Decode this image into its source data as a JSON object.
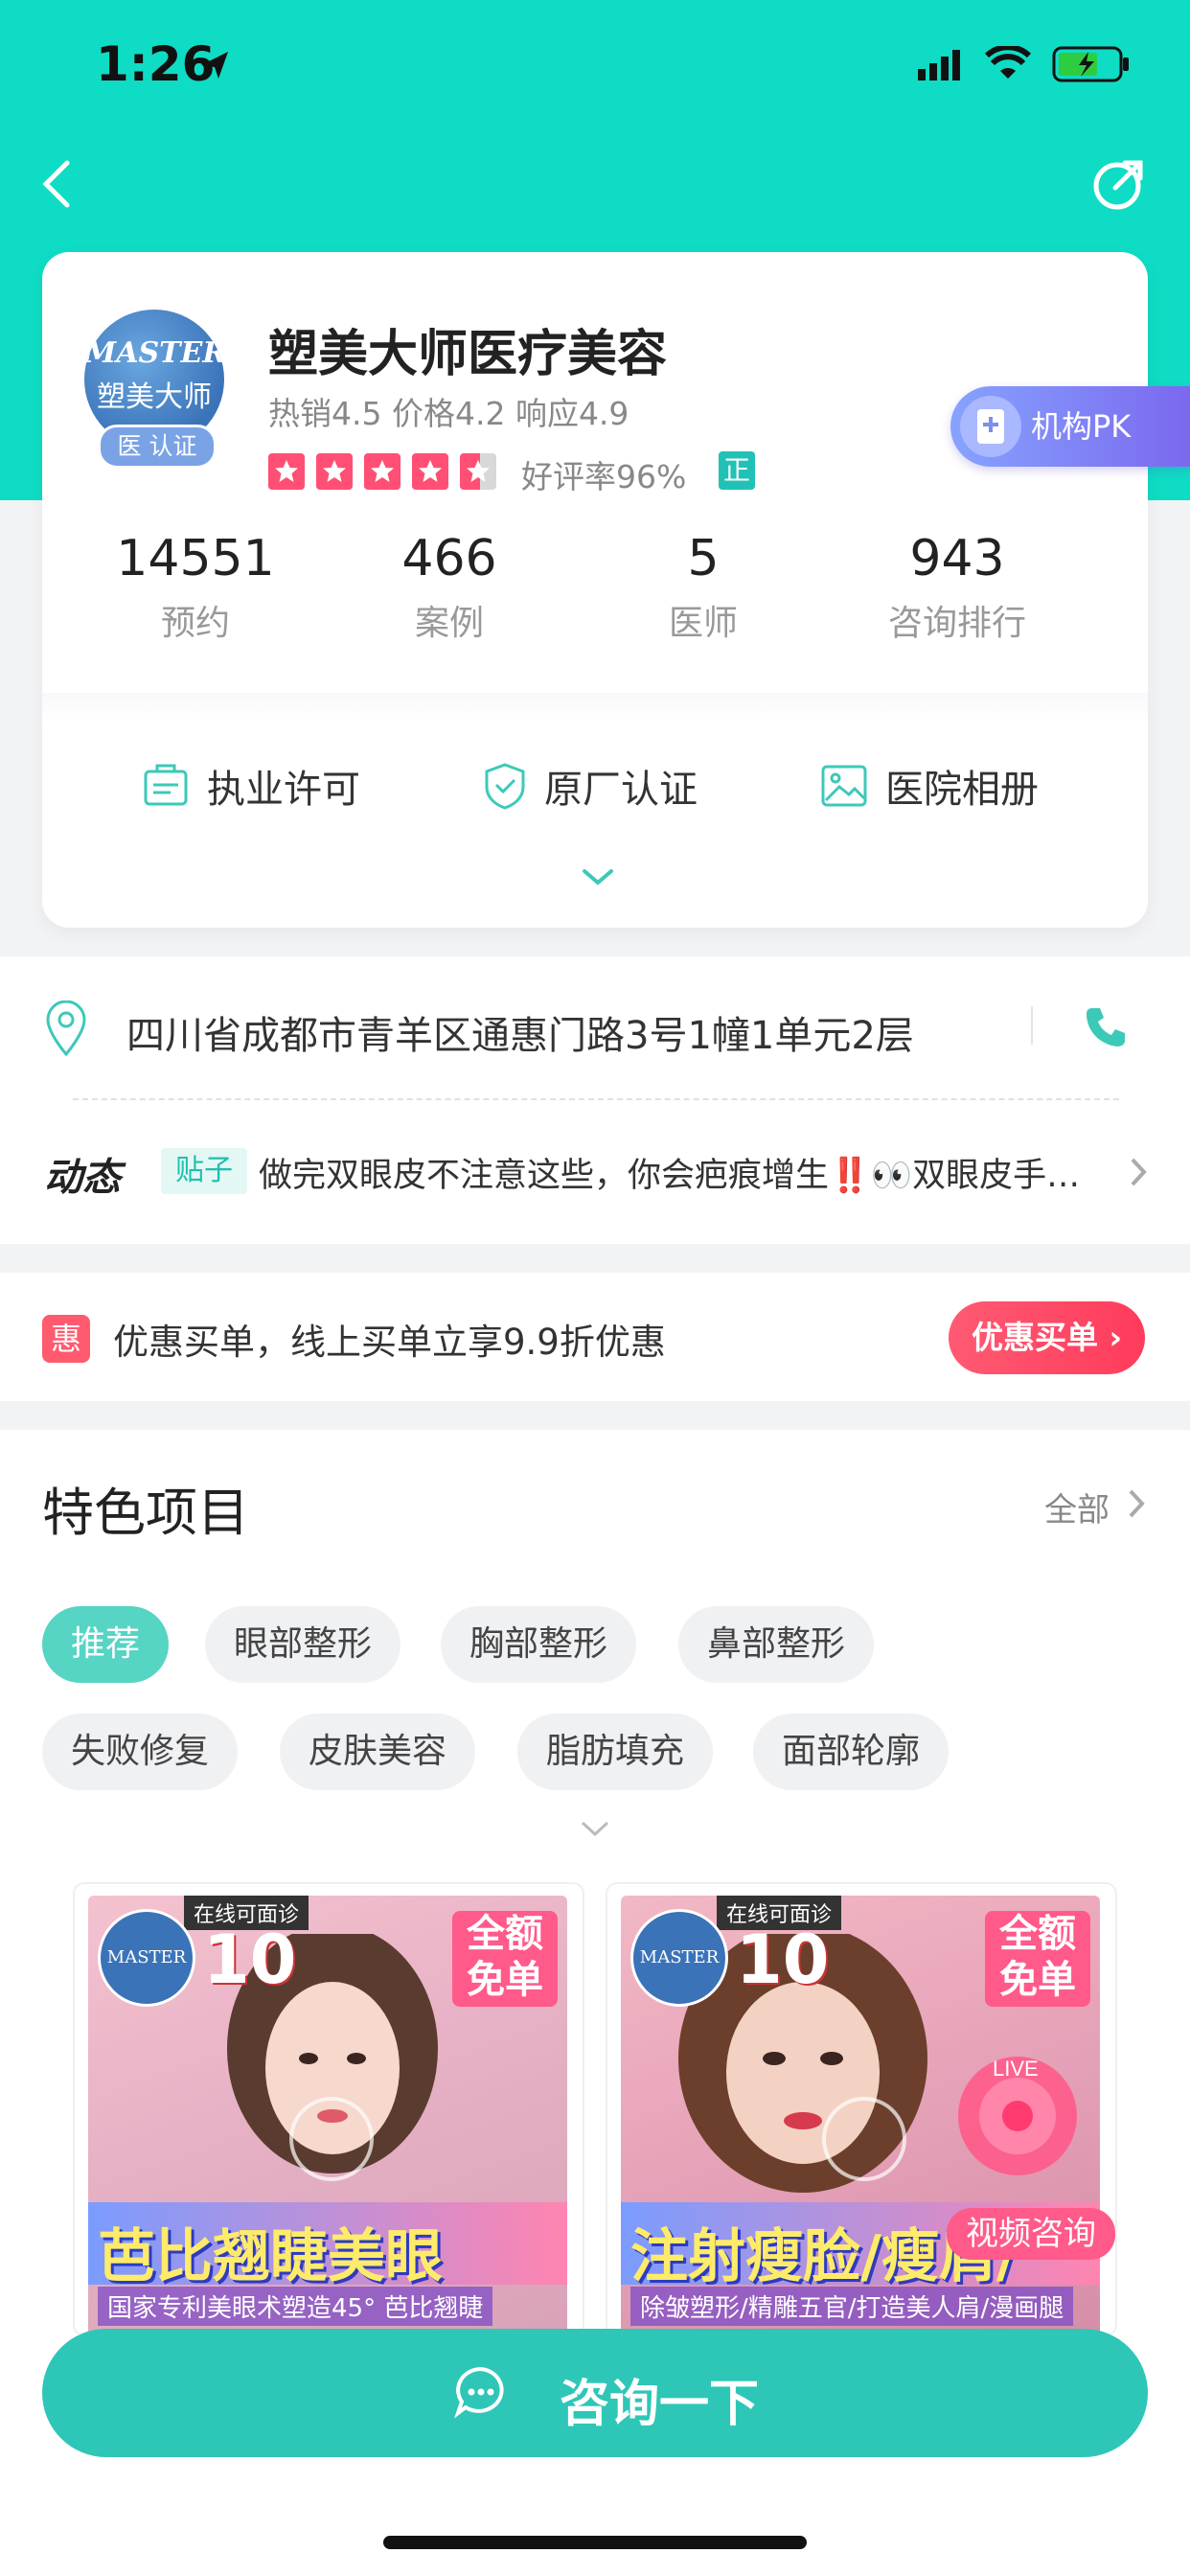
{
  "status_bar": {
    "time": "1:26"
  },
  "clinic": {
    "logo_text_1": "MASTER",
    "logo_text_2": "塑美大师",
    "cert_badge": "医 认证",
    "name": "塑美大师医疗美容",
    "scores": "热销4.5 价格4.2 响应4.9",
    "rating_text": "好评率96%",
    "zheng_badge": "正",
    "pk_label": "机构PK"
  },
  "stats": [
    {
      "value": "14551",
      "label": "预约"
    },
    {
      "value": "466",
      "label": "案例"
    },
    {
      "value": "5",
      "label": "医师"
    },
    {
      "value": "943",
      "label": "咨询排行"
    }
  ],
  "features": [
    {
      "label": "执业许可",
      "icon": "license-icon"
    },
    {
      "label": "原厂认证",
      "icon": "shield-check-icon"
    },
    {
      "label": "医院相册",
      "icon": "photo-album-icon"
    }
  ],
  "address": "四川省成都市青羊区通惠门路3号1幢1单元2层",
  "dynamics": {
    "logo": "动态",
    "tag": "贴子",
    "post_text": "做完双眼皮不注意这些，你会疤痕增生‼️👀双眼皮手…"
  },
  "promo": {
    "badge": "惠",
    "text": "优惠买单，线上买单立享9.9折优惠",
    "button": "优惠买单 ›"
  },
  "featured": {
    "title": "特色项目",
    "see_all": "全部",
    "chips": [
      "推荐",
      "眼部整形",
      "胸部整形",
      "鼻部整形",
      "失败修复",
      "皮肤美容",
      "脂肪填充",
      "面部轮廓"
    ]
  },
  "products": [
    {
      "online": "在线可面诊",
      "logo": "MASTER",
      "num": "10",
      "tag_1": "全额",
      "tag_2": "免单",
      "title": "芭比翘睫美眼",
      "sub": "国家专利美眼术塑造45° 芭比翘睫"
    },
    {
      "online": "在线可面诊",
      "logo": "MASTER",
      "num": "10",
      "tag_1": "全额",
      "tag_2": "免单",
      "title": "注射瘦脸/瘦肩/",
      "sub": "除皱塑形/精雕五官/打造美人肩/漫画腿",
      "live": "LIVE",
      "video_consult": "视频咨询"
    }
  ],
  "cta": {
    "label": "咨询一下"
  },
  "colors": {
    "brand": "#0fdcc4",
    "cta": "#2ec6b7",
    "promo": "#ff3b5b",
    "pk": "#7b68ee"
  }
}
